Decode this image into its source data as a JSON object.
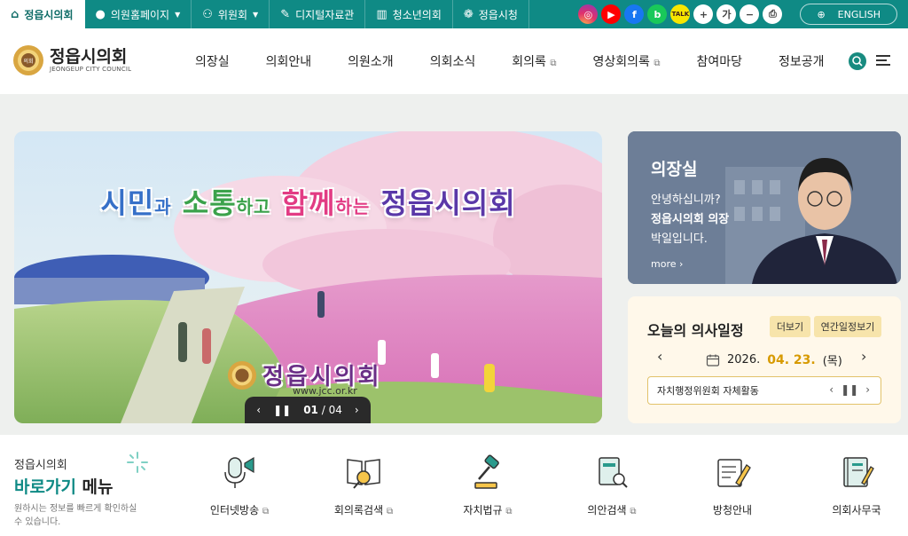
{
  "topbar": {
    "tabs": [
      {
        "label": "정읍시의회",
        "icon": "home-icon",
        "active": true
      },
      {
        "label": "의원홈페이지",
        "icon": "person-icon",
        "dropdown": true
      },
      {
        "label": "위원회",
        "icon": "group-icon",
        "dropdown": true
      },
      {
        "label": "디지털자료관",
        "icon": "pen-icon"
      },
      {
        "label": "청소년의회",
        "icon": "book-icon"
      },
      {
        "label": "정읍시청",
        "icon": "city-hall-icon"
      }
    ],
    "social": {
      "talk": "TALK",
      "font_size_label": "가",
      "plus": "+",
      "minus": "−"
    },
    "english": "ENGLISH"
  },
  "header": {
    "logo_title": "정읍시의회",
    "logo_sub": "JEONGEUP CITY COUNCIL",
    "emblem_text": "의회",
    "nav": [
      {
        "label": "의장실",
        "external": false
      },
      {
        "label": "의회안내",
        "external": false
      },
      {
        "label": "의원소개",
        "external": false
      },
      {
        "label": "의회소식",
        "external": false
      },
      {
        "label": "회의록",
        "external": true
      },
      {
        "label": "영상회의록",
        "external": true
      },
      {
        "label": "참여마당",
        "external": false
      },
      {
        "label": "정보공개",
        "external": false
      }
    ]
  },
  "hero": {
    "slogan": {
      "p1": "시민",
      "p2": "과",
      "p3": "소통",
      "p4": "하고",
      "p5": "함께",
      "p6": "하는",
      "p7": "정읍시의회"
    },
    "council": "정읍시의회",
    "url": "www.jcc.or.kr",
    "slide_current": "01",
    "slide_sep": "/",
    "slide_total": "04"
  },
  "chair": {
    "title": "의장실",
    "line1": "안녕하십니까?",
    "line2": "정읍시의회 의장",
    "line3": "박일입니다.",
    "more": "more"
  },
  "schedule": {
    "title": "오늘의 의사일정",
    "more_btn": "더보기",
    "annual_btn": "연간일정보기",
    "date_prefix": "2026.",
    "date_highlight": "04. 23.",
    "weekday": "(목)",
    "item": "자치행정위원회 자체활동"
  },
  "quick": {
    "label1": "정읍시의회",
    "label2_a": "바로가기",
    "label2_b": " 메뉴",
    "desc": "원하시는 정보를 빠르게 확인하실 수 있습니다.",
    "items": [
      {
        "label": "인터넷방송",
        "external": true
      },
      {
        "label": "회의록검색",
        "external": true
      },
      {
        "label": "자치법규",
        "external": true
      },
      {
        "label": "의안검색",
        "external": true
      },
      {
        "label": "방청안내",
        "external": false
      },
      {
        "label": "의회사무국",
        "external": false
      }
    ]
  },
  "colors": {
    "brand": "#0f8a85",
    "accent": "#d79a00",
    "schedule_bg": "#fff8ea"
  }
}
